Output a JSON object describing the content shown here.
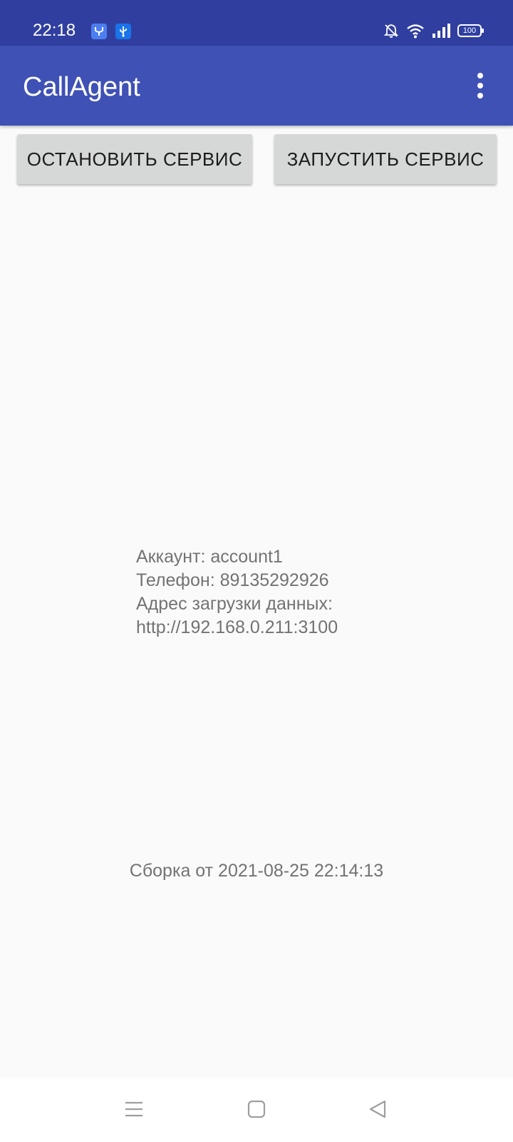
{
  "status_bar": {
    "time": "22:18",
    "battery_level": "100",
    "background_color": "#303f9f"
  },
  "app_bar": {
    "title": "CallAgent",
    "background_color": "#3f51b5",
    "menu_icon": "more-vert-icon"
  },
  "actions": {
    "stop_service_label": "ОСТАНОВИТЬ СЕРВИС",
    "start_service_label": "ЗАПУСТИТЬ СЕРВИС"
  },
  "info": {
    "account_line": "Аккаунт: account1",
    "phone_line": "Телефон: 89135292926",
    "upload_address_label": "Адрес загрузки данных:",
    "upload_address_value": "http://192.168.0.211:3100"
  },
  "build": {
    "label": "Сборка от 2021-08-25 22:14:13"
  },
  "nav_bar": {
    "recents_icon": "menu-icon",
    "home_icon": "square-icon",
    "back_icon": "triangle-back-icon"
  }
}
